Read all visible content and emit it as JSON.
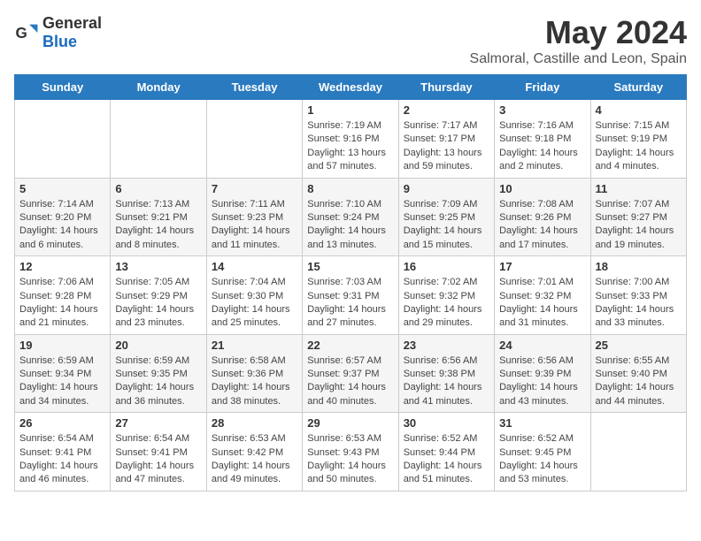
{
  "header": {
    "logo_general": "General",
    "logo_blue": "Blue",
    "title": "May 2024",
    "subtitle": "Salmoral, Castille and Leon, Spain"
  },
  "weekdays": [
    "Sunday",
    "Monday",
    "Tuesday",
    "Wednesday",
    "Thursday",
    "Friday",
    "Saturday"
  ],
  "weeks": [
    [
      {
        "day": "",
        "sunrise": "",
        "sunset": "",
        "daylight": ""
      },
      {
        "day": "",
        "sunrise": "",
        "sunset": "",
        "daylight": ""
      },
      {
        "day": "",
        "sunrise": "",
        "sunset": "",
        "daylight": ""
      },
      {
        "day": "1",
        "sunrise": "Sunrise: 7:19 AM",
        "sunset": "Sunset: 9:16 PM",
        "daylight": "Daylight: 13 hours and 57 minutes."
      },
      {
        "day": "2",
        "sunrise": "Sunrise: 7:17 AM",
        "sunset": "Sunset: 9:17 PM",
        "daylight": "Daylight: 13 hours and 59 minutes."
      },
      {
        "day": "3",
        "sunrise": "Sunrise: 7:16 AM",
        "sunset": "Sunset: 9:18 PM",
        "daylight": "Daylight: 14 hours and 2 minutes."
      },
      {
        "day": "4",
        "sunrise": "Sunrise: 7:15 AM",
        "sunset": "Sunset: 9:19 PM",
        "daylight": "Daylight: 14 hours and 4 minutes."
      }
    ],
    [
      {
        "day": "5",
        "sunrise": "Sunrise: 7:14 AM",
        "sunset": "Sunset: 9:20 PM",
        "daylight": "Daylight: 14 hours and 6 minutes."
      },
      {
        "day": "6",
        "sunrise": "Sunrise: 7:13 AM",
        "sunset": "Sunset: 9:21 PM",
        "daylight": "Daylight: 14 hours and 8 minutes."
      },
      {
        "day": "7",
        "sunrise": "Sunrise: 7:11 AM",
        "sunset": "Sunset: 9:23 PM",
        "daylight": "Daylight: 14 hours and 11 minutes."
      },
      {
        "day": "8",
        "sunrise": "Sunrise: 7:10 AM",
        "sunset": "Sunset: 9:24 PM",
        "daylight": "Daylight: 14 hours and 13 minutes."
      },
      {
        "day": "9",
        "sunrise": "Sunrise: 7:09 AM",
        "sunset": "Sunset: 9:25 PM",
        "daylight": "Daylight: 14 hours and 15 minutes."
      },
      {
        "day": "10",
        "sunrise": "Sunrise: 7:08 AM",
        "sunset": "Sunset: 9:26 PM",
        "daylight": "Daylight: 14 hours and 17 minutes."
      },
      {
        "day": "11",
        "sunrise": "Sunrise: 7:07 AM",
        "sunset": "Sunset: 9:27 PM",
        "daylight": "Daylight: 14 hours and 19 minutes."
      }
    ],
    [
      {
        "day": "12",
        "sunrise": "Sunrise: 7:06 AM",
        "sunset": "Sunset: 9:28 PM",
        "daylight": "Daylight: 14 hours and 21 minutes."
      },
      {
        "day": "13",
        "sunrise": "Sunrise: 7:05 AM",
        "sunset": "Sunset: 9:29 PM",
        "daylight": "Daylight: 14 hours and 23 minutes."
      },
      {
        "day": "14",
        "sunrise": "Sunrise: 7:04 AM",
        "sunset": "Sunset: 9:30 PM",
        "daylight": "Daylight: 14 hours and 25 minutes."
      },
      {
        "day": "15",
        "sunrise": "Sunrise: 7:03 AM",
        "sunset": "Sunset: 9:31 PM",
        "daylight": "Daylight: 14 hours and 27 minutes."
      },
      {
        "day": "16",
        "sunrise": "Sunrise: 7:02 AM",
        "sunset": "Sunset: 9:32 PM",
        "daylight": "Daylight: 14 hours and 29 minutes."
      },
      {
        "day": "17",
        "sunrise": "Sunrise: 7:01 AM",
        "sunset": "Sunset: 9:32 PM",
        "daylight": "Daylight: 14 hours and 31 minutes."
      },
      {
        "day": "18",
        "sunrise": "Sunrise: 7:00 AM",
        "sunset": "Sunset: 9:33 PM",
        "daylight": "Daylight: 14 hours and 33 minutes."
      }
    ],
    [
      {
        "day": "19",
        "sunrise": "Sunrise: 6:59 AM",
        "sunset": "Sunset: 9:34 PM",
        "daylight": "Daylight: 14 hours and 34 minutes."
      },
      {
        "day": "20",
        "sunrise": "Sunrise: 6:59 AM",
        "sunset": "Sunset: 9:35 PM",
        "daylight": "Daylight: 14 hours and 36 minutes."
      },
      {
        "day": "21",
        "sunrise": "Sunrise: 6:58 AM",
        "sunset": "Sunset: 9:36 PM",
        "daylight": "Daylight: 14 hours and 38 minutes."
      },
      {
        "day": "22",
        "sunrise": "Sunrise: 6:57 AM",
        "sunset": "Sunset: 9:37 PM",
        "daylight": "Daylight: 14 hours and 40 minutes."
      },
      {
        "day": "23",
        "sunrise": "Sunrise: 6:56 AM",
        "sunset": "Sunset: 9:38 PM",
        "daylight": "Daylight: 14 hours and 41 minutes."
      },
      {
        "day": "24",
        "sunrise": "Sunrise: 6:56 AM",
        "sunset": "Sunset: 9:39 PM",
        "daylight": "Daylight: 14 hours and 43 minutes."
      },
      {
        "day": "25",
        "sunrise": "Sunrise: 6:55 AM",
        "sunset": "Sunset: 9:40 PM",
        "daylight": "Daylight: 14 hours and 44 minutes."
      }
    ],
    [
      {
        "day": "26",
        "sunrise": "Sunrise: 6:54 AM",
        "sunset": "Sunset: 9:41 PM",
        "daylight": "Daylight: 14 hours and 46 minutes."
      },
      {
        "day": "27",
        "sunrise": "Sunrise: 6:54 AM",
        "sunset": "Sunset: 9:41 PM",
        "daylight": "Daylight: 14 hours and 47 minutes."
      },
      {
        "day": "28",
        "sunrise": "Sunrise: 6:53 AM",
        "sunset": "Sunset: 9:42 PM",
        "daylight": "Daylight: 14 hours and 49 minutes."
      },
      {
        "day": "29",
        "sunrise": "Sunrise: 6:53 AM",
        "sunset": "Sunset: 9:43 PM",
        "daylight": "Daylight: 14 hours and 50 minutes."
      },
      {
        "day": "30",
        "sunrise": "Sunrise: 6:52 AM",
        "sunset": "Sunset: 9:44 PM",
        "daylight": "Daylight: 14 hours and 51 minutes."
      },
      {
        "day": "31",
        "sunrise": "Sunrise: 6:52 AM",
        "sunset": "Sunset: 9:45 PM",
        "daylight": "Daylight: 14 hours and 53 minutes."
      },
      {
        "day": "",
        "sunrise": "",
        "sunset": "",
        "daylight": ""
      }
    ]
  ]
}
